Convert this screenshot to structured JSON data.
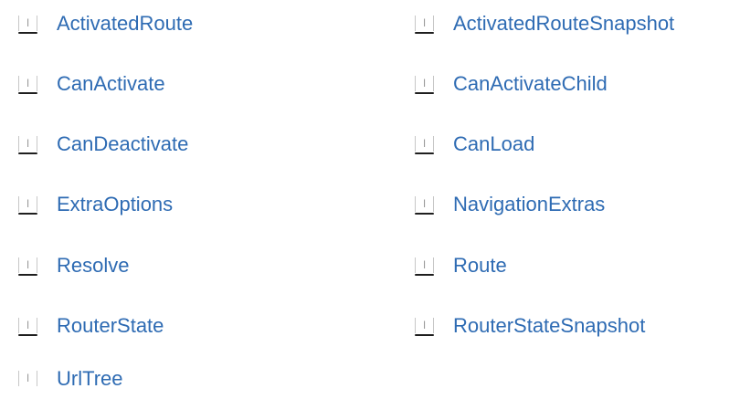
{
  "icon": {
    "name": "interface-icon",
    "glyph": "I",
    "link_color": "#2e6bb3",
    "glyph_color": "#9a9a9a"
  },
  "items": [
    {
      "label": "ActivatedRoute"
    },
    {
      "label": "ActivatedRouteSnapshot"
    },
    {
      "label": "CanActivate"
    },
    {
      "label": "CanActivateChild"
    },
    {
      "label": "CanDeactivate"
    },
    {
      "label": "CanLoad"
    },
    {
      "label": "ExtraOptions"
    },
    {
      "label": "NavigationExtras"
    },
    {
      "label": "Resolve"
    },
    {
      "label": "Route"
    },
    {
      "label": "RouterState"
    },
    {
      "label": "RouterStateSnapshot"
    },
    {
      "label": "UrlTree"
    }
  ]
}
